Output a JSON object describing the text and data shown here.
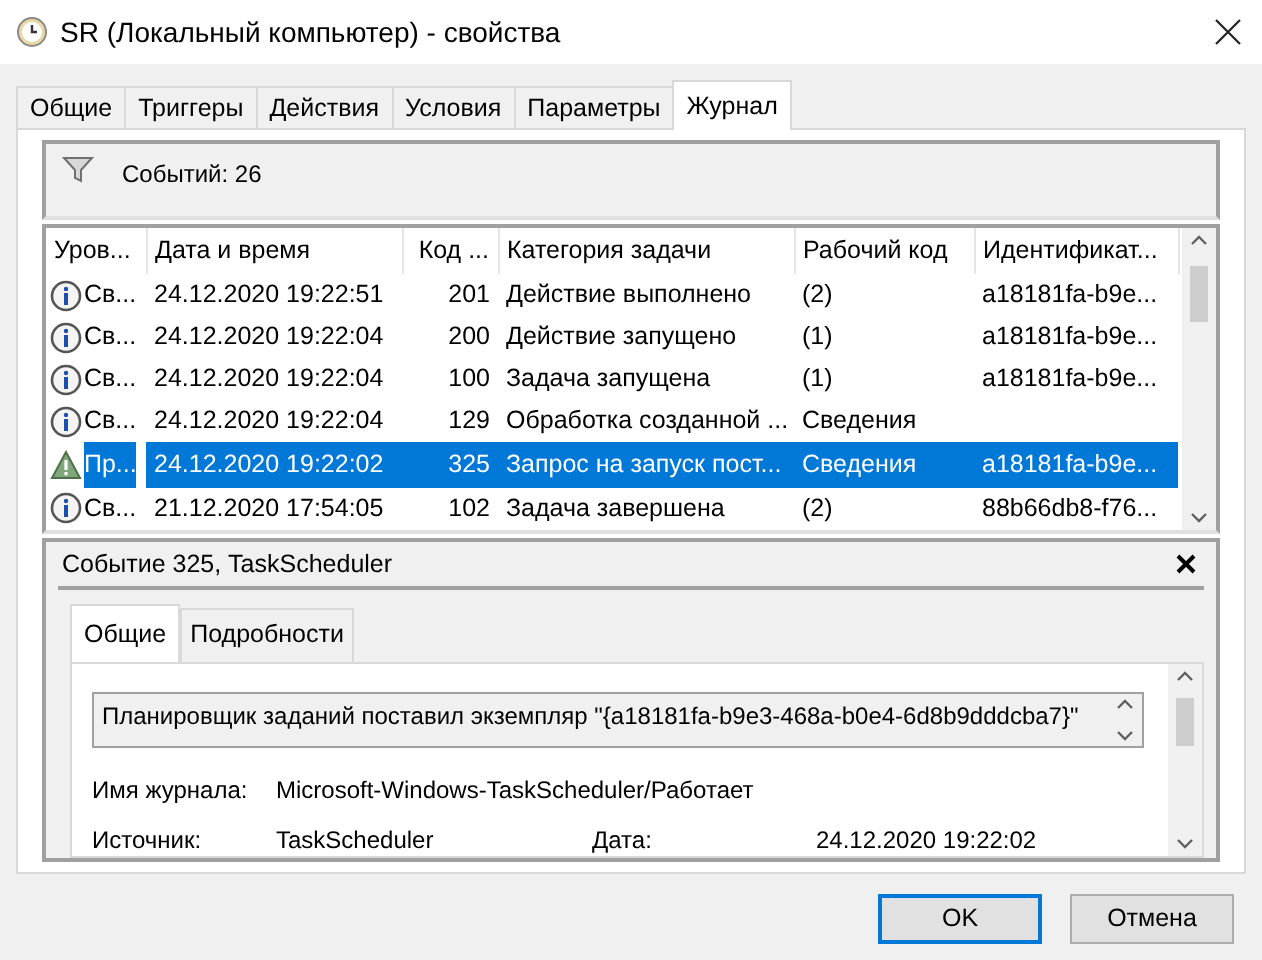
{
  "window": {
    "title": "SR (Локальный компьютер) - свойства"
  },
  "tabs": [
    {
      "label": "Общие",
      "selected": false
    },
    {
      "label": "Триггеры",
      "selected": false
    },
    {
      "label": "Действия",
      "selected": false
    },
    {
      "label": "Условия",
      "selected": false
    },
    {
      "label": "Параметры",
      "selected": false
    },
    {
      "label": "Журнал",
      "selected": true
    }
  ],
  "filter_bar": {
    "events_count": "Событий: 26"
  },
  "events_table": {
    "columns": [
      "Уров...",
      "Дата и время",
      "Код ...",
      "Категория задачи",
      "Рабочий код",
      "Идентификат..."
    ],
    "rows": [
      {
        "kind": "info",
        "level": "Св...",
        "datetime": "24.12.2020 19:22:51",
        "code": "201",
        "category": "Действие выполнено",
        "op_code": "(2)",
        "id": "a18181fa-b9e...",
        "selected": false
      },
      {
        "kind": "info",
        "level": "Св...",
        "datetime": "24.12.2020 19:22:04",
        "code": "200",
        "category": "Действие запущено",
        "op_code": "(1)",
        "id": "a18181fa-b9e...",
        "selected": false
      },
      {
        "kind": "info",
        "level": "Св...",
        "datetime": "24.12.2020 19:22:04",
        "code": "100",
        "category": "Задача запущена",
        "op_code": "(1)",
        "id": "a18181fa-b9e...",
        "selected": false
      },
      {
        "kind": "info",
        "level": "Св...",
        "datetime": "24.12.2020 19:22:04",
        "code": "129",
        "category": "Обработка созданной ...",
        "op_code": "Сведения",
        "id": "",
        "selected": false
      },
      {
        "kind": "warning",
        "level": "Пр...",
        "datetime": "24.12.2020 19:22:02",
        "code": "325",
        "category": "Запрос на запуск пост...",
        "op_code": "Сведения",
        "id": "a18181fa-b9e...",
        "selected": true
      },
      {
        "kind": "info",
        "level": "Св...",
        "datetime": "21.12.2020 17:54:05",
        "code": "102",
        "category": "Задача завершена",
        "op_code": "(2)",
        "id": "88b66db8-f76...",
        "selected": false
      }
    ]
  },
  "event_details": {
    "title": "Событие 325, TaskScheduler",
    "tabs": [
      {
        "label": "Общие",
        "selected": true
      },
      {
        "label": "Подробности",
        "selected": false
      }
    ],
    "description": "Планировщик заданий поставил экземпляр \"{a18181fa-b9e3-468a-b0e4-6d8b9dddcba7}\"",
    "field_rows": [
      [
        {
          "label": "Имя журнала:",
          "value": "Microsoft-Windows-TaskScheduler/Работает"
        }
      ],
      [
        {
          "label": "Источник:",
          "value": "TaskScheduler"
        },
        {
          "label": "Дата:",
          "value": "24.12.2020 19:22:02"
        }
      ]
    ]
  },
  "buttons": [
    {
      "label": "OK",
      "default": true
    },
    {
      "label": "Отмена",
      "default": false
    }
  ]
}
